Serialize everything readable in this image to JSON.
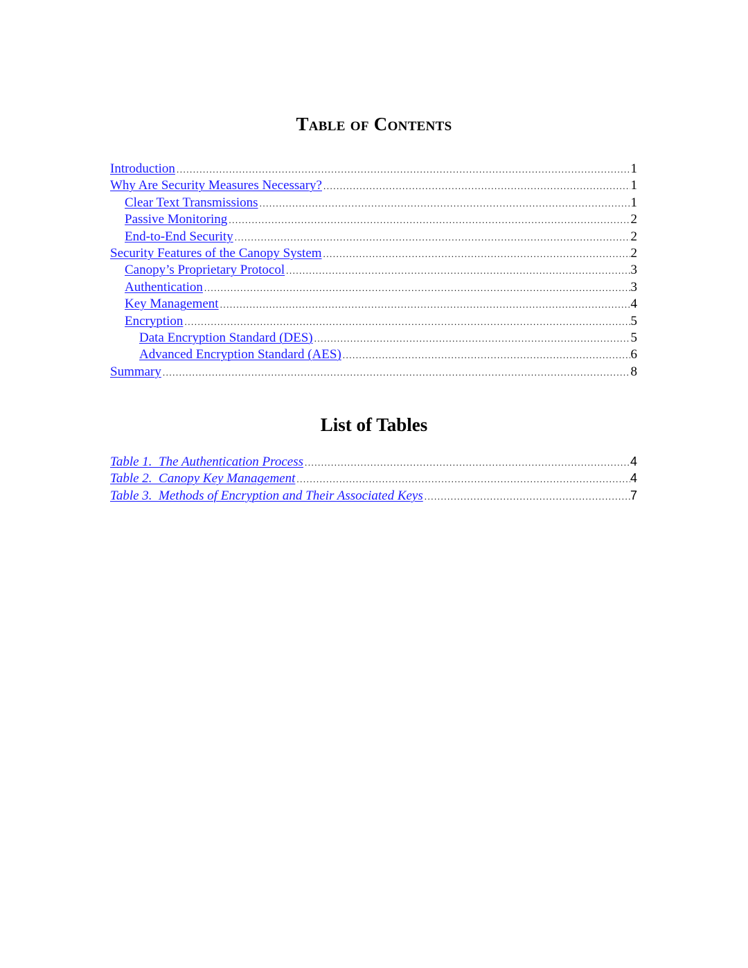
{
  "toc": {
    "heading": "Table of Contents",
    "entries": [
      {
        "label": "Introduction",
        "page": "1",
        "level": 1
      },
      {
        "label": "Why Are Security Measures Necessary?",
        "page": "1",
        "level": 1
      },
      {
        "label": "Clear Text Transmissions",
        "page": "1",
        "level": 2
      },
      {
        "label": "Passive Monitoring",
        "page": "2",
        "level": 2
      },
      {
        "label": "End-to-End Security",
        "page": "2",
        "level": 2
      },
      {
        "label": "Security Features of the Canopy System",
        "page": "2",
        "level": 1
      },
      {
        "label": "Canopy’s Proprietary Protocol",
        "page": "3",
        "level": 2
      },
      {
        "label": "Authentication",
        "page": "3",
        "level": 2
      },
      {
        "label": "Key Management",
        "page": "4",
        "level": 2
      },
      {
        "label": "Encryption",
        "page": "5",
        "level": 2
      },
      {
        "label": "Data Encryption Standard (DES)",
        "page": "5",
        "level": 3
      },
      {
        "label": "Advanced Encryption Standard (AES)",
        "page": "6",
        "level": 3
      },
      {
        "label": "Summary",
        "page": "8",
        "level": 1
      }
    ]
  },
  "list_of_tables": {
    "heading": "List of Tables",
    "entries": [
      {
        "label": "Table 1.  The Authentication Process",
        "page": "4"
      },
      {
        "label": "Table 2.  Canopy Key Management",
        "page": "4"
      },
      {
        "label": "Table 3.  Methods of Encryption and Their Associated Keys",
        "page": "7"
      }
    ]
  },
  "colors": {
    "link": "#1a1aff",
    "text": "#000000",
    "background": "#ffffff"
  }
}
